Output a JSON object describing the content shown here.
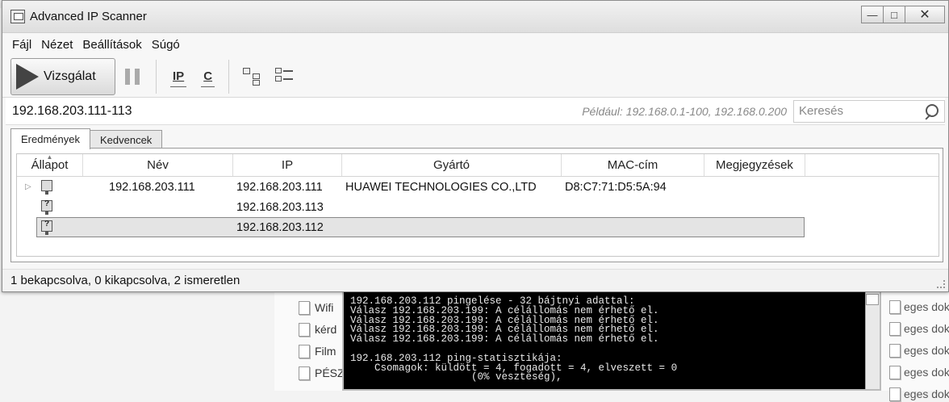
{
  "window": {
    "title": "Advanced IP Scanner",
    "minimize": "—",
    "maximize": "□",
    "close": "✕"
  },
  "menu": [
    "Fájl",
    "Nézet",
    "Beállítások",
    "Súgó"
  ],
  "toolbar": {
    "scan_label": "Vizsgálat",
    "ip_label": "IP",
    "c_label": "C"
  },
  "address": {
    "range": "192.168.203.111-113",
    "example": "Például: 192.168.0.1-100, 192.168.0.200",
    "search_placeholder": "Keresés"
  },
  "tabs": [
    "Eredmények",
    "Kedvencek"
  ],
  "columns": [
    "Állapot",
    "Név",
    "IP",
    "Gyártó",
    "MAC-cím",
    "Megjegyzések"
  ],
  "rows": [
    {
      "status": "known",
      "name": "192.168.203.111",
      "ip": "192.168.203.111",
      "vendor": "HUAWEI TECHNOLOGIES CO.,LTD",
      "mac": "D8:C7:71:D5:5A:94",
      "comment": ""
    },
    {
      "status": "unknown",
      "name": "",
      "ip": "192.168.203.113",
      "vendor": "",
      "mac": "",
      "comment": ""
    },
    {
      "status": "unknown",
      "name": "",
      "ip": "192.168.203.112",
      "vendor": "",
      "mac": "",
      "comment": "",
      "selected": true
    }
  ],
  "status": "1 bekapcsolva, 0 kikapcsolva, 2 ismeretlen",
  "explorer": {
    "left_items": [
      "Wifi",
      "kérd",
      "Film",
      "PÉSZ"
    ],
    "right_items": [
      "eges dokum",
      "eges dokum",
      "eges dokum",
      "eges dokum",
      "eges dokum"
    ]
  },
  "console": {
    "lines": [
      "192.168.203.112 pingelése - 32 bájtnyi adattal:",
      "Válasz 192.168.203.199: A célállomás nem érhető el.",
      "Válasz 192.168.203.199: A célállomás nem érhető el.",
      "Válasz 192.168.203.199: A célállomás nem érhető el.",
      "Válasz 192.168.203.199: A célállomás nem érhető el.",
      "",
      "192.168.203.112 ping-statisztikája:",
      "    Csomagok: küldött = 4, fogadott = 4, elveszett = 0",
      "                    (0% veszteség),"
    ]
  }
}
